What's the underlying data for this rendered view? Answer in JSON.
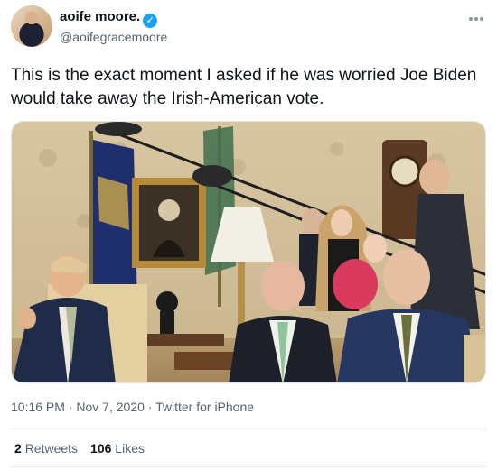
{
  "author": {
    "display_name": "aoife moore.",
    "handle": "@aoifegracemoore",
    "verified_icon": "verified-check-icon"
  },
  "tweet": {
    "text": "This is the exact moment I asked if he was worried Joe Biden would take away the Irish-American vote."
  },
  "meta": {
    "time": "10:16 PM",
    "date": "Nov 7, 2020",
    "separator": "·",
    "source": "Twitter for iPhone"
  },
  "stats": {
    "retweets_count": "2",
    "retweets_label": "Retweets",
    "likes_count": "106",
    "likes_label": "Likes"
  },
  "icons": {
    "more": "more-options-icon"
  }
}
